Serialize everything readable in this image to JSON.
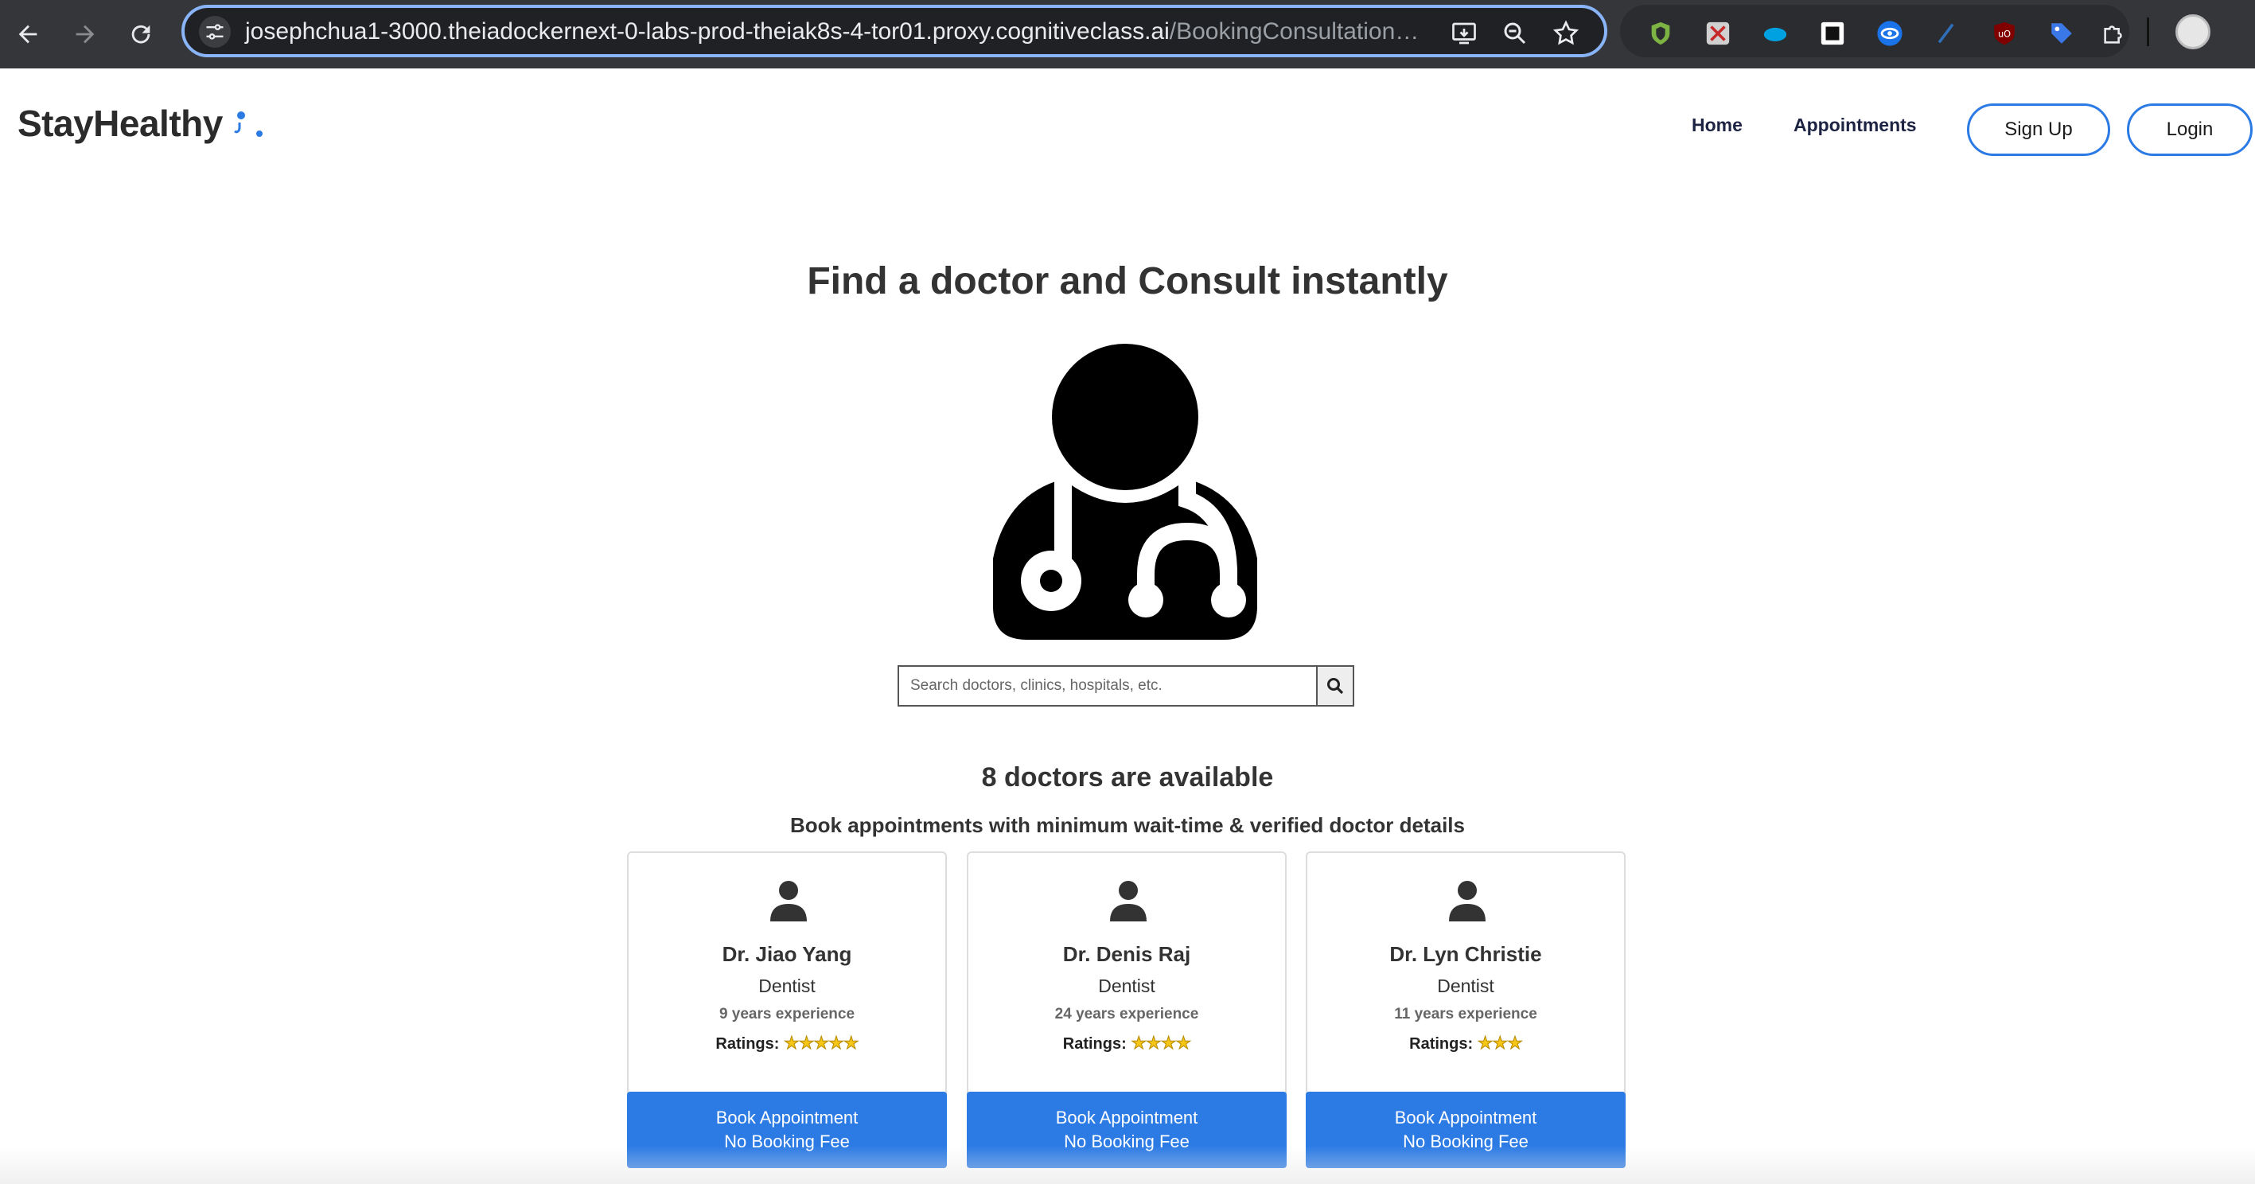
{
  "browser": {
    "url_host": "josephchua1-3000.theiadockernext-0-labs-prod-theiak8s-4-tor01.proxy.cognitiveclass.ai",
    "url_path": "/BookingConsultation…"
  },
  "site": {
    "logo_text": "StayHealthy",
    "nav": {
      "home": "Home",
      "appointments": "Appointments",
      "signup": "Sign Up",
      "login": "Login"
    }
  },
  "hero": {
    "title": "Find a doctor and Consult instantly",
    "search_placeholder": "Search doctors, clinics, hospitals, etc."
  },
  "listing": {
    "count_text": "8 doctors are available",
    "subtitle": "Book appointments with minimum wait-time & verified doctor details",
    "ratings_label": "Ratings:",
    "doctors": [
      {
        "name": "Dr. Jiao Yang",
        "speciality": "Dentist",
        "experience": "9 years experience",
        "stars": "★★★★★",
        "book_line1": "Book Appointment",
        "book_line2": "No Booking Fee"
      },
      {
        "name": "Dr. Denis Raj",
        "speciality": "Dentist",
        "experience": "24 years experience",
        "stars": "★★★★",
        "book_line1": "Book Appointment",
        "book_line2": "No Booking Fee"
      },
      {
        "name": "Dr. Lyn Christie",
        "speciality": "Dentist",
        "experience": "11 years experience",
        "stars": "★★★",
        "book_line1": "Book Appointment",
        "book_line2": "No Booking Fee"
      }
    ]
  },
  "colors": {
    "accent": "#2c7be5",
    "chrome_bg": "#35363a",
    "text_dark": "#333333"
  }
}
